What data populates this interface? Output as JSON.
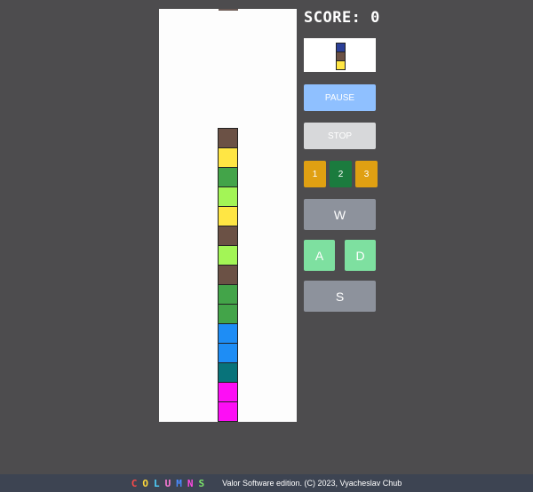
{
  "score": {
    "label": "SCORE: 0"
  },
  "next_piece": {
    "colors": [
      "#2b3f97",
      "#6b5145",
      "#ffe644"
    ]
  },
  "board": {
    "column_cells": [
      "#6b5145",
      "#ffe644",
      "#43a449",
      "#a3f556",
      "#ffe644",
      "#6b5145",
      "#a3f556",
      "#6b5145",
      "#43a449",
      "#43a449",
      "#1e8df5",
      "#1e8df5",
      "#08737a",
      "#fd0ef5",
      "#fd0ef5"
    ]
  },
  "controls": {
    "pause_label": "PAUSE",
    "stop_label": "STOP",
    "levels": [
      "1",
      "2",
      "3"
    ],
    "active_level": "2",
    "keys": {
      "w": "W",
      "a": "A",
      "d": "D",
      "s": "S"
    }
  },
  "footer": {
    "logo_letters": [
      {
        "ch": "C",
        "color": "#ff4a4a"
      },
      {
        "ch": "O",
        "color": "#ffd93b"
      },
      {
        "ch": "L",
        "color": "#4fd3ff"
      },
      {
        "ch": "U",
        "color": "#ff7ad9"
      },
      {
        "ch": "M",
        "color": "#4a8bff"
      },
      {
        "ch": "N",
        "color": "#ff4ae2"
      },
      {
        "ch": "S",
        "color": "#7be36b"
      }
    ],
    "credit": "Valor Software edition. (C) 2023, Vyacheslav Chub"
  }
}
